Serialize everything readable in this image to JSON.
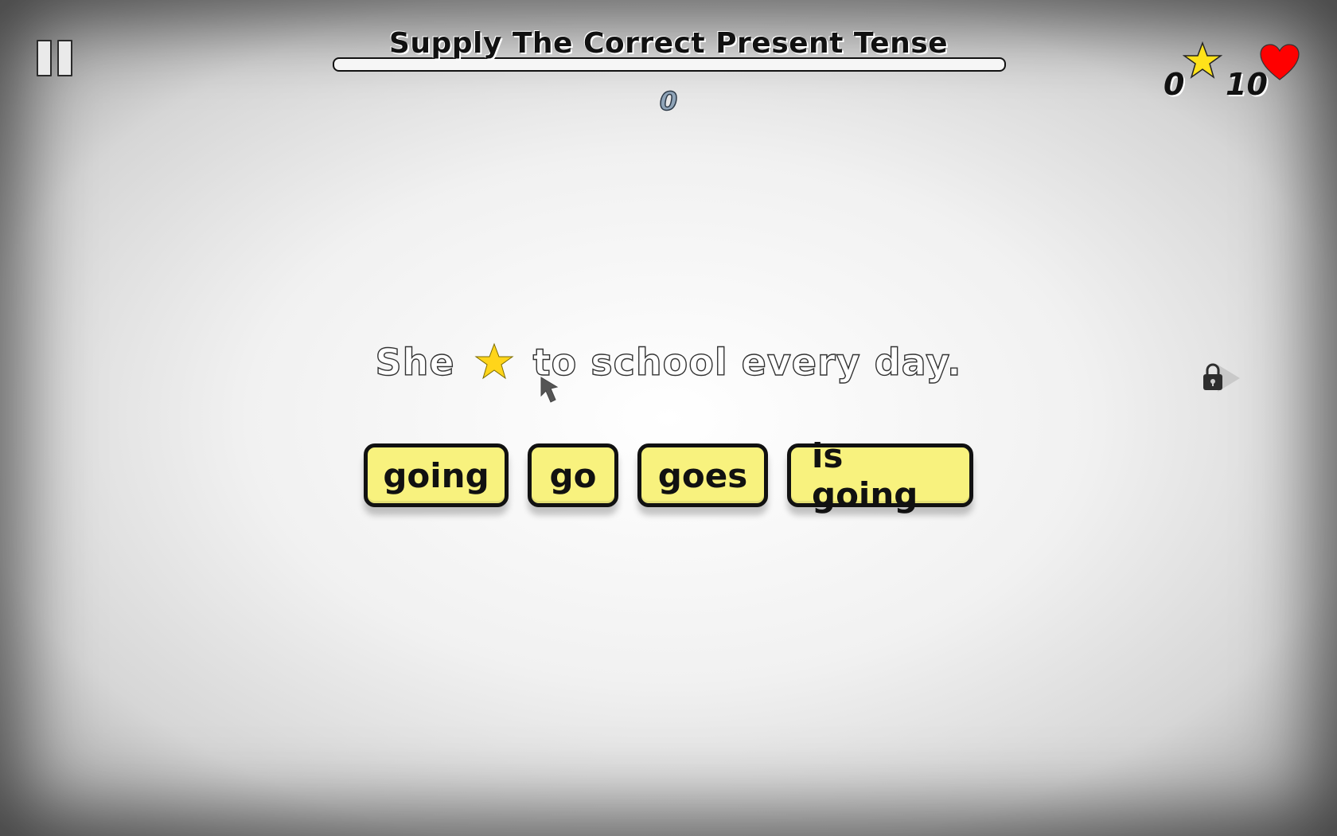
{
  "header": {
    "title": "Supply The Correct Present Tense",
    "progress_fraction": 0,
    "question_counter": "0"
  },
  "scores": {
    "stars": "0",
    "lives": "10",
    "star_icon": "star-icon",
    "heart_icon": "heart-icon",
    "star_color": "#ffe21a",
    "heart_color": "#ff0000"
  },
  "question": {
    "before_blank": "She",
    "after_blank": "to school every day."
  },
  "answers": [
    {
      "label": "going"
    },
    {
      "label": "go"
    },
    {
      "label": "goes"
    },
    {
      "label": "is going"
    }
  ],
  "colors": {
    "button_fill": "#f8f27e",
    "button_border": "#111111"
  }
}
